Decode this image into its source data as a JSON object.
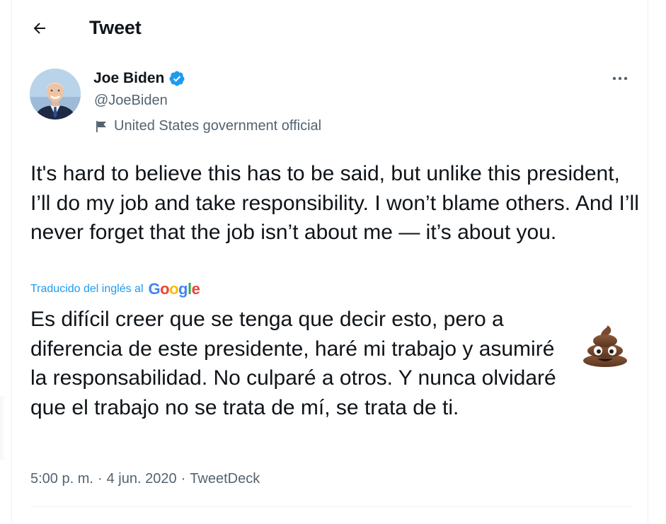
{
  "header": {
    "title": "Tweet",
    "back_icon": "arrow-left-icon"
  },
  "author": {
    "name": "Joe Biden",
    "handle": "@JoeBiden",
    "verified": true,
    "label": "United States government official",
    "label_icon": "flag-icon"
  },
  "tweet": {
    "text": "It's hard to believe this has to be said, but unlike this president, I’ll do my job and take responsibility. I won’t blame others. And I’ll never forget that the job isn’t about me — it’s about you.",
    "translated_label": "Traducido del inglés al",
    "translator": "Google",
    "translation_main": "Es difícil creer que se tenga que decir esto, pero a diferencia de este presidente, haré mi trabajo y asumiré la responsabilidad. No culparé a otros. Y nunca olvidaré que el trabajo no se trata de mí, se trata de ti.",
    "time": "5:00 p. m.",
    "date": "4 jun. 2020",
    "source": "TweetDeck",
    "separator": "·"
  },
  "colors": {
    "accent": "#1d9bf0",
    "text": "#0f1419",
    "secondary": "#536471",
    "border": "#eff3f4"
  }
}
